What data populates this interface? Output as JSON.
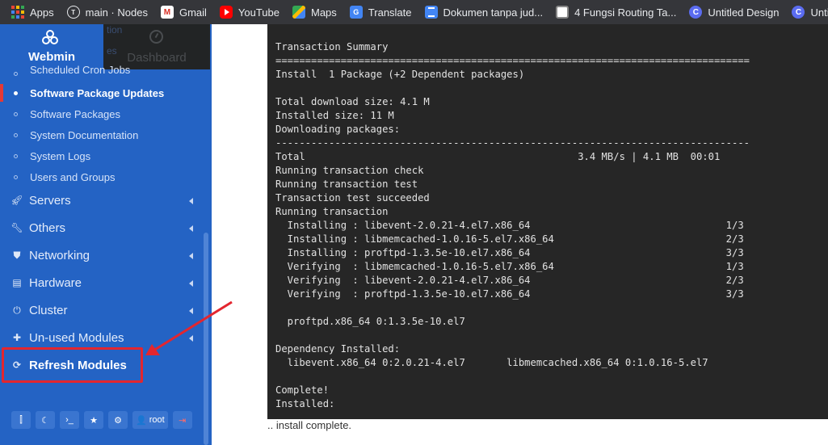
{
  "bookmarks": [
    {
      "label": "Apps",
      "icon": "apps-grid-icon"
    },
    {
      "label": "main · Nodes",
      "icon": "nodes-icon"
    },
    {
      "label": "Gmail",
      "icon": "gmail-icon"
    },
    {
      "label": "YouTube",
      "icon": "youtube-icon"
    },
    {
      "label": "Maps",
      "icon": "maps-icon"
    },
    {
      "label": "Translate",
      "icon": "translate-icon"
    },
    {
      "label": "Dokumen tanpa jud...",
      "icon": "docs-icon"
    },
    {
      "label": "4 Fungsi Routing Ta...",
      "icon": "routing-icon"
    },
    {
      "label": "Untitled Design",
      "icon": "canva-icon"
    },
    {
      "label": "Untitled Des",
      "icon": "canva-icon"
    }
  ],
  "sidebar": {
    "brand": "Webmin",
    "dashboard_tab": "Dashboard",
    "ghost_texts": [
      "tion",
      "es"
    ],
    "subitems": [
      {
        "label": "Scheduled Cron Jobs",
        "active": false
      },
      {
        "label": "Software Package Updates",
        "active": true
      },
      {
        "label": "Software Packages",
        "active": false
      },
      {
        "label": "System Documentation",
        "active": false
      },
      {
        "label": "System Logs",
        "active": false
      },
      {
        "label": "Users and Groups",
        "active": false
      }
    ],
    "categories": [
      {
        "label": "Servers",
        "icon": "rocket-icon"
      },
      {
        "label": "Others",
        "icon": "wrench-icon"
      },
      {
        "label": "Networking",
        "icon": "shield-icon"
      },
      {
        "label": "Hardware",
        "icon": "hard-drive-icon"
      },
      {
        "label": "Cluster",
        "icon": "power-icon"
      },
      {
        "label": "Un-used Modules",
        "icon": "puzzle-icon"
      }
    ],
    "refresh_label": "Refresh Modules",
    "bottom_buttons": [
      {
        "name": "toggle-frame-button",
        "icon": "toggle-frame-icon",
        "glyph": "⫿"
      },
      {
        "name": "night-mode-button",
        "icon": "moon-icon",
        "glyph": "☾"
      },
      {
        "name": "terminal-button",
        "icon": "terminal-icon",
        "glyph": "›_"
      },
      {
        "name": "favorites-button",
        "icon": "star-icon",
        "glyph": "★"
      },
      {
        "name": "settings-button",
        "icon": "gears-icon",
        "glyph": "⚙"
      },
      {
        "name": "user-button",
        "icon": "user-icon",
        "glyph": "👤"
      },
      {
        "name": "logout-button",
        "icon": "logout-icon",
        "glyph": "⇥"
      }
    ],
    "user_label": "root"
  },
  "terminal": {
    "lines": [
      "Transaction Summary",
      "================================================================================",
      "Install  1 Package (+2 Dependent packages)",
      "",
      "Total download size: 4.1 M",
      "Installed size: 11 M",
      "Downloading packages:",
      "--------------------------------------------------------------------------------",
      "Total                                              3.4 MB/s | 4.1 MB  00:01",
      "Running transaction check",
      "Running transaction test",
      "Transaction test succeeded",
      "Running transaction",
      "  Installing : libevent-2.0.21-4.el7.x86_64                                 1/3",
      "  Installing : libmemcached-1.0.16-5.el7.x86_64                             2/3",
      "  Installing : proftpd-1.3.5e-10.el7.x86_64                                 3/3",
      "  Verifying  : libmemcached-1.0.16-5.el7.x86_64                             1/3",
      "  Verifying  : libevent-2.0.21-4.el7.x86_64                                 2/3",
      "  Verifying  : proftpd-1.3.5e-10.el7.x86_64                                 3/3",
      "",
      "  proftpd.x86_64 0:1.3.5e-10.el7",
      "",
      "Dependency Installed:",
      "  libevent.x86_64 0:2.0.21-4.el7       libmemcached.x86_64 0:1.0.16-5.el7",
      "",
      "Complete!",
      "Installed:"
    ]
  },
  "status": ".. install complete.",
  "colors": {
    "sidebar": "#2463c4",
    "terminal_bg": "#262626",
    "annotation_red": "#e3262f"
  }
}
